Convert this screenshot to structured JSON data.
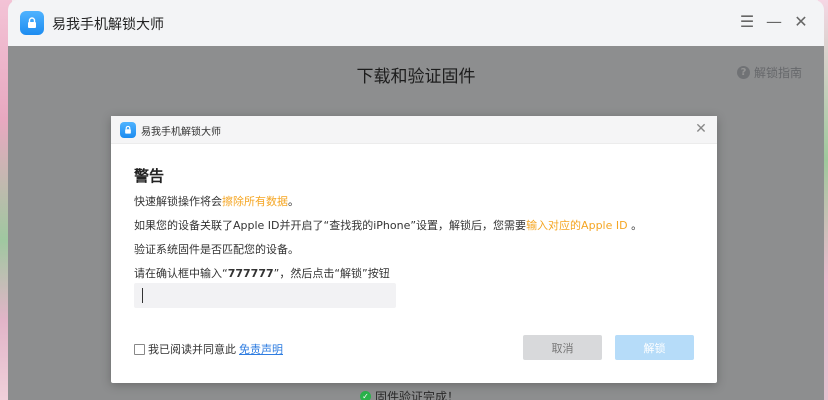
{
  "app": {
    "title": "易我手机解锁大师"
  },
  "window_controls": {
    "menu": "☰",
    "minimize": "—",
    "close": "✕"
  },
  "page": {
    "heading": "下载和验证固件",
    "help_label": "解锁指南",
    "status_text": "固件验证完成！"
  },
  "dialog": {
    "title": "易我手机解锁大师",
    "warning_title": "警告",
    "line1": {
      "pre": "快速解锁操作将会",
      "highlight": "擦除所有数据",
      "post": "。"
    },
    "line2": {
      "pre": "如果您的设备关联了Apple ID并开启了“查找我的iPhone”设置，解锁后，您需要",
      "highlight": "输入对应的Apple ID",
      "post": " 。"
    },
    "line3": "验证系统固件是否匹配您的设备。",
    "line4": {
      "pre": "请在确认框中输入“",
      "code": "777777",
      "post": "”，然后点击“解锁”按钮"
    },
    "input_value": "",
    "agree_text": "我已阅读并同意此",
    "agree_link": "免责声明",
    "cancel_label": "取消",
    "unlock_label": "解锁"
  },
  "colors": {
    "accent": "#f5a623",
    "link": "#2f7de1",
    "unlock_button": "#b6dcf9"
  }
}
